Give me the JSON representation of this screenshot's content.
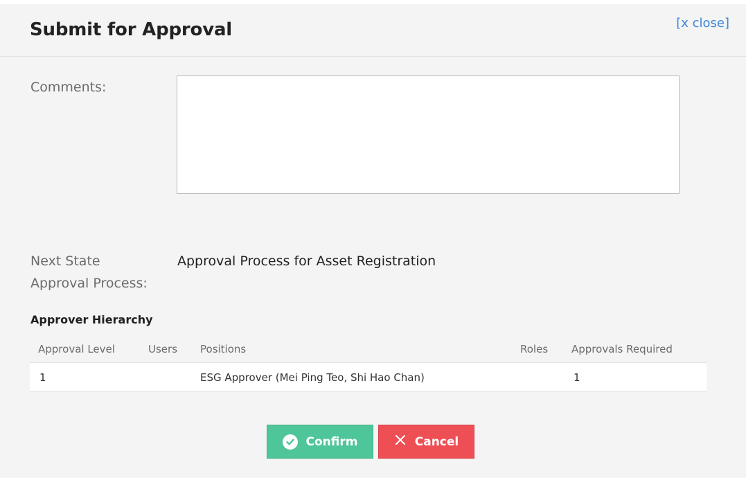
{
  "dialog": {
    "title": "Submit for Approval",
    "close_label": "[x close]"
  },
  "form": {
    "comments_label": "Comments:",
    "comments_value": "",
    "next_state_label_line1": "Next State",
    "next_state_label_line2": "Approval Process:",
    "next_state_value": "Approval Process for Asset Registration"
  },
  "hierarchy": {
    "heading": "Approver Hierarchy",
    "columns": [
      "Approval Level",
      "Users",
      "Positions",
      "Roles",
      "Approvals Required"
    ],
    "rows": [
      {
        "approval_level": "1",
        "users": "",
        "positions": "ESG Approver (Mei Ping Teo, Shi Hao Chan)",
        "roles": "",
        "approvals_required": "1"
      }
    ]
  },
  "buttons": {
    "confirm_label": "Confirm",
    "cancel_label": "Cancel"
  },
  "icons": {
    "confirm": "check-circle-icon",
    "cancel": "x-icon"
  },
  "colors": {
    "confirm": "#4fc59a",
    "cancel": "#ee4f55",
    "link": "#3b86d8",
    "background": "#f4f4f4"
  }
}
